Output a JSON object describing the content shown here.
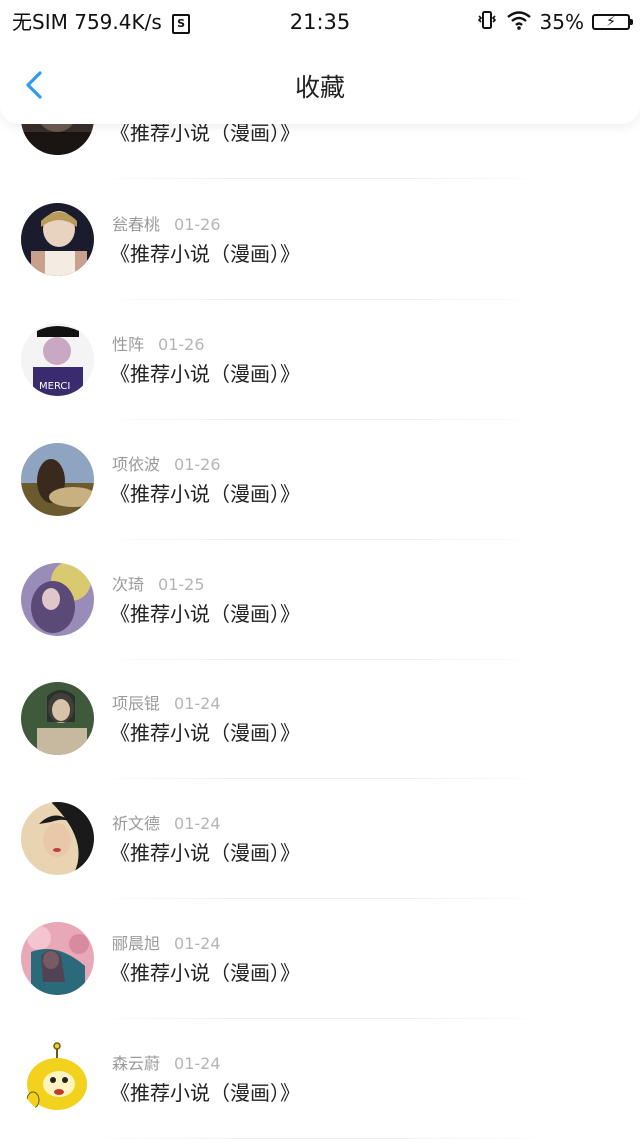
{
  "status_bar": {
    "carrier": "无SIM",
    "speed": "759.4K/s",
    "sim_badge": "S",
    "time": "21:35",
    "battery": "35%"
  },
  "nav": {
    "title": "收藏",
    "back_icon": "chevron-left-icon",
    "accent_color": "#2e9bf0"
  },
  "items": [
    {
      "name": "",
      "date": "",
      "title": "《推荐小说（漫画）》",
      "avatar_colors": [
        "#3a2e2a",
        "#6b5a50",
        "#1a1412"
      ]
    },
    {
      "name": "瓮春桃",
      "date": "01-26",
      "title": "《推荐小说（漫画）》",
      "avatar_colors": [
        "#1a1c2e",
        "#e8d2c0",
        "#c7a18c"
      ]
    },
    {
      "name": "性阵",
      "date": "01-26",
      "title": "《推荐小说（漫画）》",
      "avatar_colors": [
        "#f4f4f4",
        "#3a2a6e",
        "#c9a8c4"
      ]
    },
    {
      "name": "项依波",
      "date": "01-26",
      "title": "《推荐小说（漫画）》",
      "avatar_colors": [
        "#8fa4c0",
        "#6b5a2e",
        "#c8b080"
      ]
    },
    {
      "name": "次琦",
      "date": "01-25",
      "title": "《推荐小说（漫画）》",
      "avatar_colors": [
        "#d9c970",
        "#5b4a78",
        "#9a8cb8"
      ]
    },
    {
      "name": "项辰锟",
      "date": "01-24",
      "title": "《推荐小说（漫画）》",
      "avatar_colors": [
        "#3f5a3a",
        "#c9b49a",
        "#2a2a2a"
      ]
    },
    {
      "name": "祈文德",
      "date": "01-24",
      "title": "《推荐小说（漫画）》",
      "avatar_colors": [
        "#1a1a1a",
        "#e8c8a8",
        "#c04040"
      ]
    },
    {
      "name": "郦晨旭",
      "date": "01-24",
      "title": "《推荐小说（漫画）》",
      "avatar_colors": [
        "#e8a8b8",
        "#2a6a7a",
        "#5a3a4a"
      ]
    },
    {
      "name": "森云蔚",
      "date": "01-24",
      "title": "《推荐小说（漫画）》",
      "avatar_colors": [
        "#f2d21c",
        "#ffffff",
        "#6a5a10"
      ]
    }
  ]
}
